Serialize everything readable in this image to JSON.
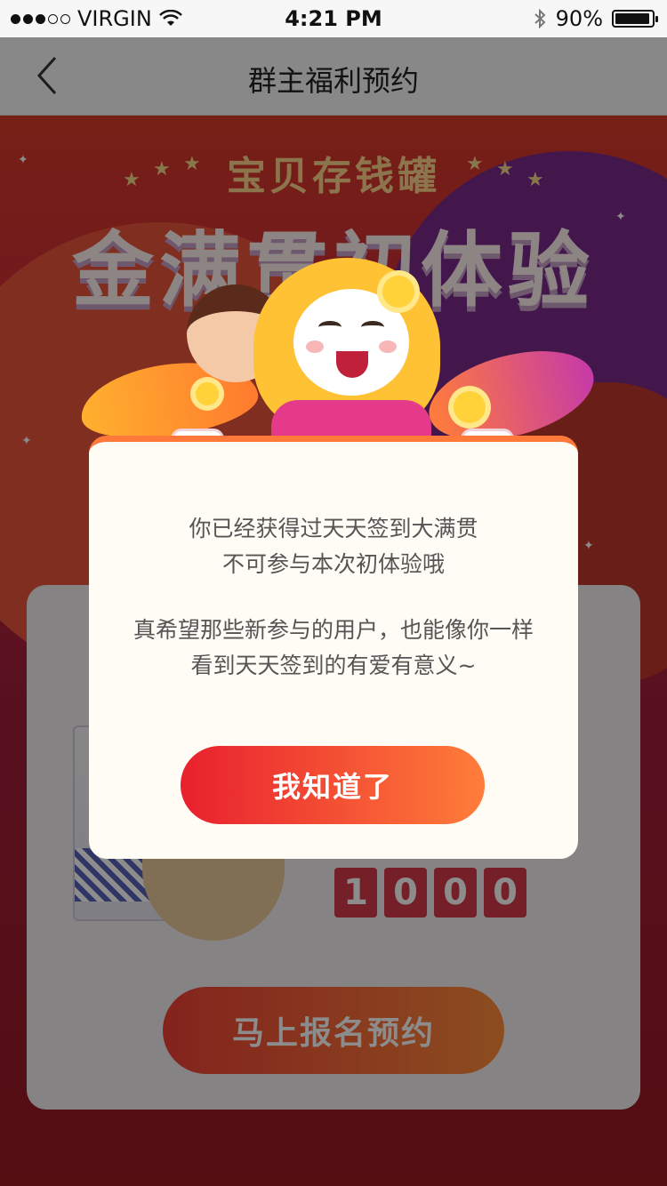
{
  "status_bar": {
    "carrier": "VIRGIN",
    "time": "4:21 PM",
    "battery": "90%"
  },
  "nav": {
    "title": "群主福利预约"
  },
  "banner": {
    "subtitle": "宝贝存钱罐",
    "title": "金满贯初体验"
  },
  "card": {
    "count_digits": [
      "1",
      "0",
      "0",
      "0"
    ],
    "signup_label": "马上报名预约"
  },
  "dialog": {
    "line1": "你已经获得过天天签到大满贯",
    "line2": "不可参与本次初体验哦",
    "line3": "真希望那些新参与的用户，也能像你一样",
    "line4": "看到天天签到的有爱有意义~",
    "button_label": "我知道了"
  },
  "colors": {
    "accent_start": "#e8202e",
    "accent_end": "#ff7d3a",
    "dialog_bg": "#fffcf5"
  }
}
